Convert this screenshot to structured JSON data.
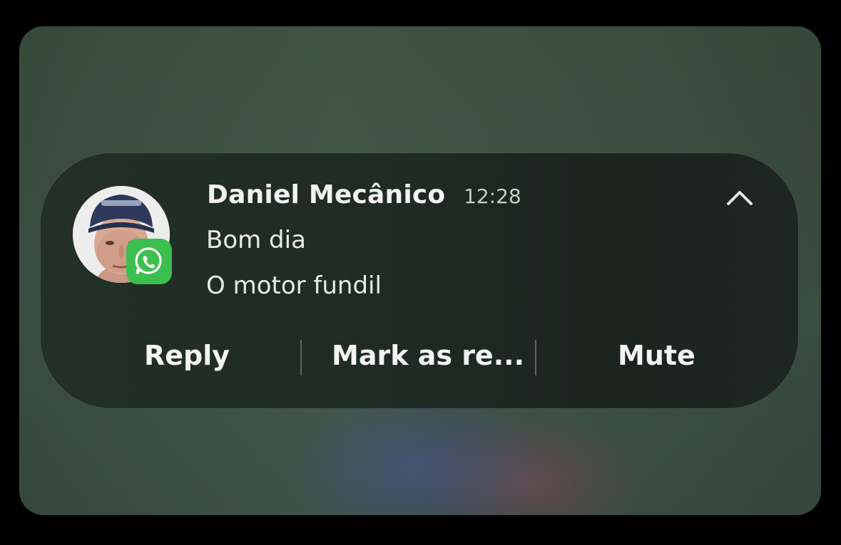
{
  "notification": {
    "sender": "Daniel Mecânico",
    "time": "12:28",
    "messages": [
      "Bom dia",
      "O motor fundil"
    ],
    "app_badge_icon": "whatsapp-icon",
    "collapse_icon": "chevron-up-icon",
    "actions": {
      "reply": "Reply",
      "mark_as_read": "Mark as re...",
      "mute": "Mute"
    }
  },
  "colors": {
    "badge": "#3cbf4f",
    "card": "#1f2b24",
    "background": "#3f5344"
  }
}
